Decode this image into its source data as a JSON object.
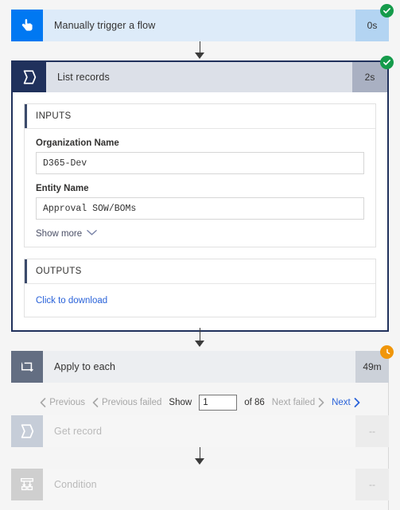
{
  "colors": {
    "trigger_accent": "#0078f2",
    "action_accent": "#20315c",
    "loop_accent": "#636e82",
    "success": "#159b4b",
    "running": "#f0960a",
    "link": "#2962d9"
  },
  "trigger": {
    "title": "Manually trigger a flow",
    "duration": "0s",
    "status": "succeeded",
    "icon": "tap-hand-icon"
  },
  "list_records": {
    "title": "List records",
    "duration": "2s",
    "status": "succeeded",
    "icon": "dataverse-icon",
    "inputs": {
      "heading": "INPUTS",
      "fields": [
        {
          "label": "Organization Name",
          "value": "D365-Dev"
        },
        {
          "label": "Entity Name",
          "value": "Approval SOW/BOMs"
        }
      ],
      "show_more_label": "Show more"
    },
    "outputs": {
      "heading": "OUTPUTS",
      "download_label": "Click to download"
    }
  },
  "apply_to_each": {
    "title": "Apply to each",
    "duration": "49m",
    "status": "running",
    "icon": "loop-icon",
    "pagination": {
      "previous_label": "Previous",
      "previous_failed_label": "Previous failed",
      "show_label": "Show",
      "page_value": "1",
      "of_label": "of 86",
      "next_failed_label": "Next failed",
      "next_label": "Next"
    },
    "children": [
      {
        "title": "Get record",
        "duration": "--",
        "icon": "dataverse-icon",
        "state": "skipped"
      },
      {
        "title": "Condition",
        "duration": "--",
        "icon": "condition-branch-icon",
        "state": "skipped"
      }
    ]
  }
}
